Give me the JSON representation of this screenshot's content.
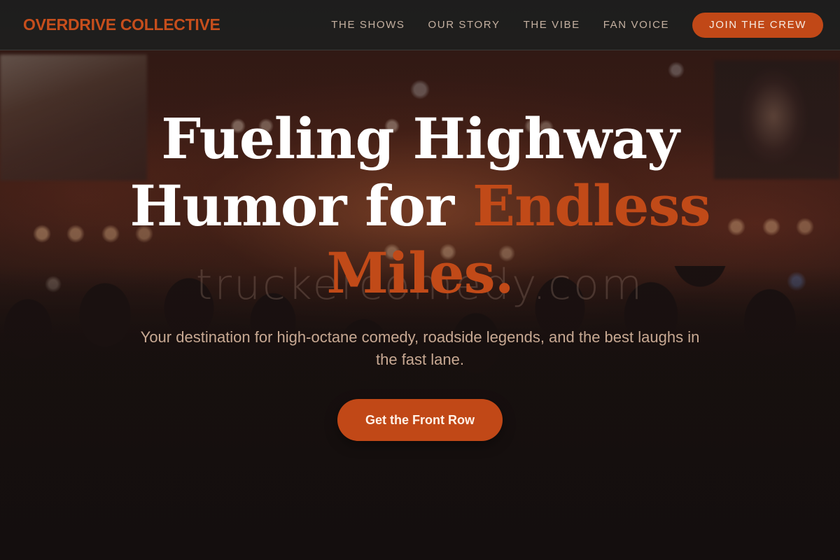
{
  "header": {
    "logo": "OVERDRIVE COLLECTIVE",
    "nav": [
      {
        "label": "THE SHOWS"
      },
      {
        "label": "OUR STORY"
      },
      {
        "label": "THE VIBE"
      },
      {
        "label": "FAN VOICE"
      }
    ],
    "cta_label": "JOIN THE CREW"
  },
  "hero": {
    "title_line1": "Fueling Highway",
    "title_line2_plain": "Humor for",
    "title_accent": "Endless Miles.",
    "subtitle": "Your destination for high-octane comedy, roadside legends, and the best laughs in the fast lane.",
    "cta_label": "Get the Front Row",
    "watermark": "truckercomedy.com"
  },
  "colors": {
    "accent": "#c14817",
    "header_bg": "#1e1e1e",
    "nav_text": "#c5b1a1",
    "subtitle_text": "#c8a993"
  }
}
